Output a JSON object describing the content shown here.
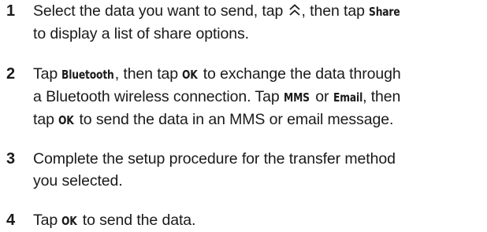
{
  "steps": [
    {
      "number": "1",
      "t1": "Select the data you want to send, tap",
      "icon": "double-chevron-up-icon",
      "t2": ", then tap",
      "kw1": "Share",
      "t3": "to display a list of share options."
    },
    {
      "number": "2",
      "t1": "Tap",
      "kw1": "Bluetooth",
      "t2": ", then tap",
      "kw2": "OK",
      "t3": "to exchange the data through",
      "t4": "a Bluetooth wireless connection. Tap",
      "kw3": "MMS",
      "t5": "or",
      "kw4": "Email",
      "t6": ", then",
      "t7": "tap",
      "kw5": "OK",
      "t8": "to send the data in an MMS or email message."
    },
    {
      "number": "3",
      "t1": "Complete the setup procedure for the transfer method",
      "t2": "you selected."
    },
    {
      "number": "4",
      "t1": "Tap",
      "kw1": "OK",
      "t2": "to send the data."
    }
  ]
}
